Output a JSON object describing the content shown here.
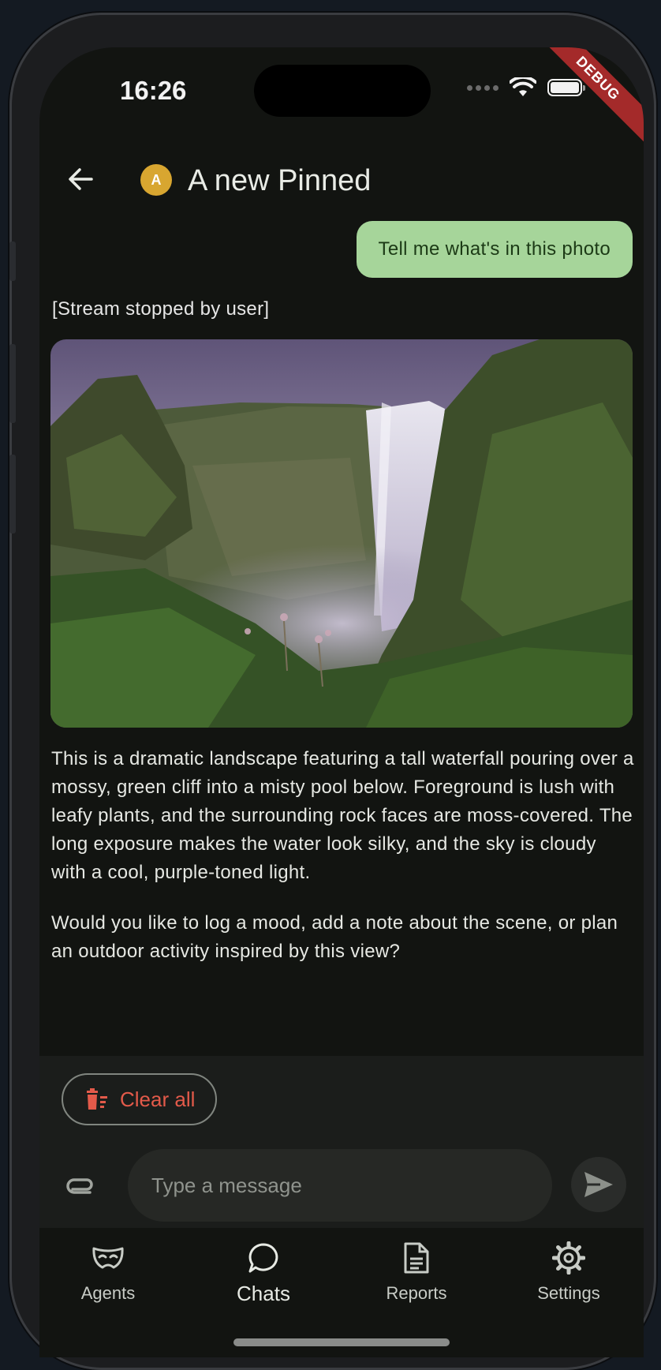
{
  "status": {
    "time": "16:26",
    "debug_label": "DEBUG"
  },
  "appbar": {
    "avatar_letter": "A",
    "title": "A new Pinned"
  },
  "messages": {
    "user_text": "Tell me what's in this photo",
    "stopped_notice": "[Stream stopped by user]",
    "reply_paragraphs": [
      "This is a dramatic landscape featuring a tall waterfall pouring over a mossy, green cliff into a misty pool below. Foreground is lush with leafy plants, and the surrounding rock faces are moss-covered. The long exposure makes the water look silky, and the sky is cloudy with a cool, purple-toned light.",
      "Would you like to log a mood, add a note about the scene, or plan an outdoor activity inspired by this view?"
    ]
  },
  "composer": {
    "clear_label": "Clear all",
    "placeholder": "Type a message"
  },
  "nav": {
    "items": [
      {
        "label": "Agents",
        "icon": "mask-icon"
      },
      {
        "label": "Chats",
        "icon": "chat-bubble-icon"
      },
      {
        "label": "Reports",
        "icon": "document-icon"
      },
      {
        "label": "Settings",
        "icon": "gear-icon"
      }
    ],
    "active": "Chats"
  },
  "colors": {
    "user_bubble": "#a6d59a",
    "avatar": "#d8a630",
    "clear_red": "#e35a4a",
    "background": "#121411"
  }
}
